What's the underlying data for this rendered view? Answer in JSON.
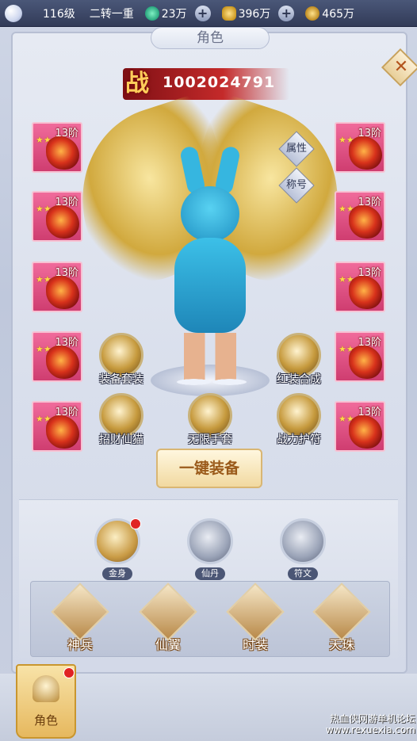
{
  "topbar": {
    "level": "116级",
    "realm": "二转一重",
    "jade": "23万",
    "ingot": "396万",
    "coin": "465万"
  },
  "panel": {
    "title": "角色",
    "close": "✕"
  },
  "power": {
    "icon": "战",
    "value": "1002024791"
  },
  "side_tags": {
    "attributes": "属性",
    "title": "称号"
  },
  "left_slots": [
    {
      "tier": "13阶"
    },
    {
      "tier": "13阶"
    },
    {
      "tier": "13阶"
    },
    {
      "tier": "13阶"
    },
    {
      "tier": "13阶"
    }
  ],
  "right_slots": [
    {
      "tier": "13阶"
    },
    {
      "tier": "13阶"
    },
    {
      "tier": "13阶"
    },
    {
      "tier": "13阶"
    },
    {
      "tier": "13阶"
    }
  ],
  "stars": "★★★★",
  "functions": {
    "equip_set": "装备套装",
    "red_synth": "红装合成",
    "lucky_cat": "招财仙猫",
    "infinite_glove": "无限手套",
    "power_charm": "战力护符"
  },
  "equip_button": "一键装备",
  "mini": {
    "golden_body": "金身",
    "elixir": "仙丹",
    "rune": "符文"
  },
  "tabs": [
    "神兵",
    "仙翼",
    "时装",
    "天珠"
  ],
  "bottom_nav": {
    "role": "角色"
  },
  "watermark": {
    "line1": "热血侠网游单机论坛",
    "line2": "www.rexuexia.com"
  }
}
